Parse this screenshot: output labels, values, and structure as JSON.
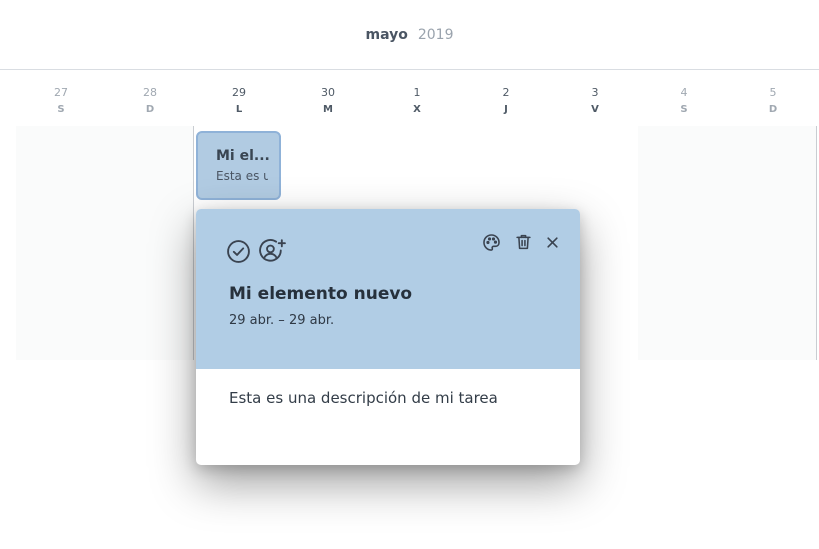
{
  "header": {
    "month": "mayo",
    "year": "2019"
  },
  "days": [
    {
      "num": "27",
      "letter": "S"
    },
    {
      "num": "28",
      "letter": "D"
    },
    {
      "num": "29",
      "letter": "L"
    },
    {
      "num": "30",
      "letter": "M"
    },
    {
      "num": "1",
      "letter": "X"
    },
    {
      "num": "2",
      "letter": "J"
    },
    {
      "num": "3",
      "letter": "V"
    },
    {
      "num": "4",
      "letter": "S"
    },
    {
      "num": "5",
      "letter": "D"
    }
  ],
  "event_chip": {
    "title": "Mi el...",
    "description": "Esta es u"
  },
  "popup": {
    "title": "Mi elemento nuevo",
    "dates": "29 abr. – 29 abr.",
    "description": "Esta es una descripción de mi tarea",
    "icons": {
      "complete": "check-circle-icon",
      "assign": "user-add-icon",
      "color": "palette-icon",
      "delete": "trash-icon",
      "close": "close-icon"
    }
  },
  "colors": {
    "event_bg": "#b1cbe2",
    "event_border": "#8fb2d8",
    "popup_header_bg": "#b1cde5",
    "weekend_bg": "#fafbfb"
  }
}
